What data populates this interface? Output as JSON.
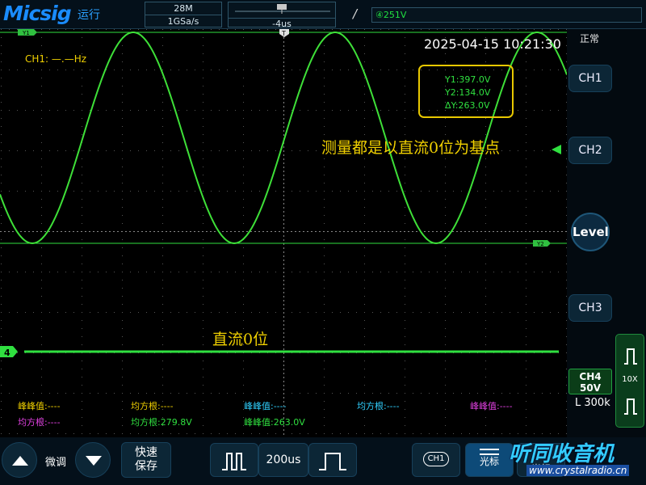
{
  "header": {
    "brand": "Micsig",
    "run_state": "运行",
    "memory_depth": "28M",
    "sample_rate": "1GSa/s",
    "trigger_position": "-4us",
    "trigger_slope": "/",
    "trigger_level": "④251V"
  },
  "screen": {
    "datetime": "2025-04-15 10:21:30",
    "ch1_frequency": "CH1: —.—Hz",
    "cursors": {
      "y1": "Y1:397.0V",
      "y2": "Y2:134.0V",
      "dy": "ΔY:263.0V"
    },
    "annotation_top": "测量都是以直流0位为基点",
    "annotation_bottom": "直流0位",
    "markers": {
      "y1": "Y1",
      "y2": "Y2",
      "trigger": "T",
      "ch4": "4"
    }
  },
  "measurements": {
    "row1": [
      {
        "text": "峰峰值:----",
        "color": "#f0d000"
      },
      {
        "text": "均方根:----",
        "color": "#f0d000"
      },
      {
        "text": "峰峰值:----",
        "color": "#30d0ff"
      },
      {
        "text": "均方根:----",
        "color": "#30d0ff"
      },
      {
        "text": "峰峰值:----",
        "color": "#e040e0"
      }
    ],
    "row2": [
      {
        "text": "均方根:----",
        "color": "#e040e0"
      },
      {
        "text": "均方根:279.8V",
        "color": "#30e040"
      },
      {
        "text": "峰峰值:263.0V",
        "color": "#30e040"
      }
    ]
  },
  "sidebar": {
    "state": "正常",
    "ch1": "CH1",
    "ch2": "CH2",
    "level": "Level",
    "ch3": "CH3",
    "ch4_label": "CH4",
    "ch4_scale": "50V",
    "ch4_impedance": "L 300k",
    "probe_ratio": "10X"
  },
  "bottom": {
    "fine_adjust": "微调",
    "auto_save_line1": "快速",
    "auto_save_line2": "保存",
    "timebase": "200us",
    "ch_button": "CH1",
    "cursor_label": "光标",
    "cursor_label2": "光标"
  },
  "watermark": {
    "title": "听同收音机",
    "url": "www.crystalradio.cn"
  },
  "colors": {
    "ch1": "#f0d000",
    "ch2": "#30d0ff",
    "ch3": "#e040e0",
    "ch4": "#30e040",
    "accent": "#1a8cff"
  }
}
